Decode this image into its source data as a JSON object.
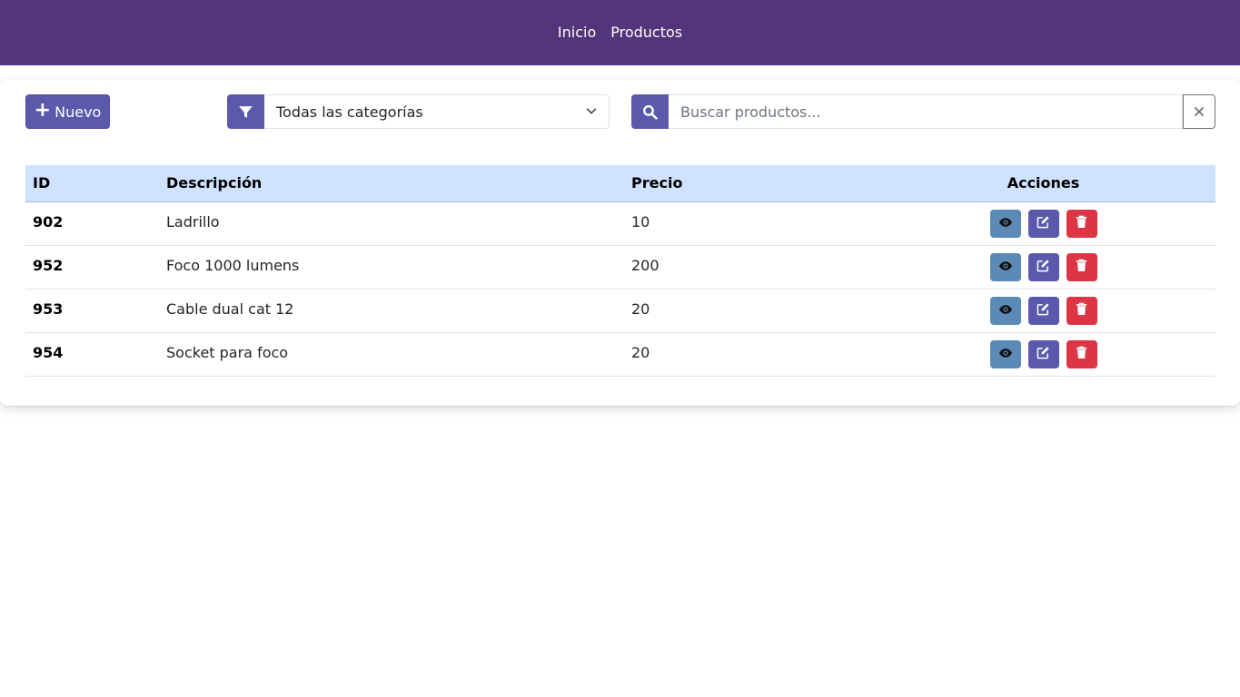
{
  "nav": {
    "links": [
      "Inicio",
      "Productos"
    ]
  },
  "toolbar": {
    "new_label": "Nuevo",
    "category_selected": "Todas las categorías",
    "search_placeholder": "Buscar productos..."
  },
  "table": {
    "headers": {
      "id": "ID",
      "description": "Descripción",
      "price": "Precio",
      "actions": "Acciones"
    },
    "rows": [
      {
        "id": "902",
        "description": "Ladrillo",
        "price": "10"
      },
      {
        "id": "952",
        "description": "Foco 1000 lumens",
        "price": "200"
      },
      {
        "id": "953",
        "description": "Cable dual cat 12",
        "price": "20"
      },
      {
        "id": "954",
        "description": "Socket para foco",
        "price": "20"
      }
    ]
  },
  "colors": {
    "navbar": "#52357b",
    "primary": "#5a59ab",
    "view": "#5a8ab5",
    "danger": "#dc3545",
    "table_header": "#cfe2ff"
  },
  "icons": [
    "plus-icon",
    "filter-icon",
    "chevron-down-icon",
    "search-icon",
    "close-icon",
    "eye-icon",
    "edit-icon",
    "trash-icon"
  ]
}
